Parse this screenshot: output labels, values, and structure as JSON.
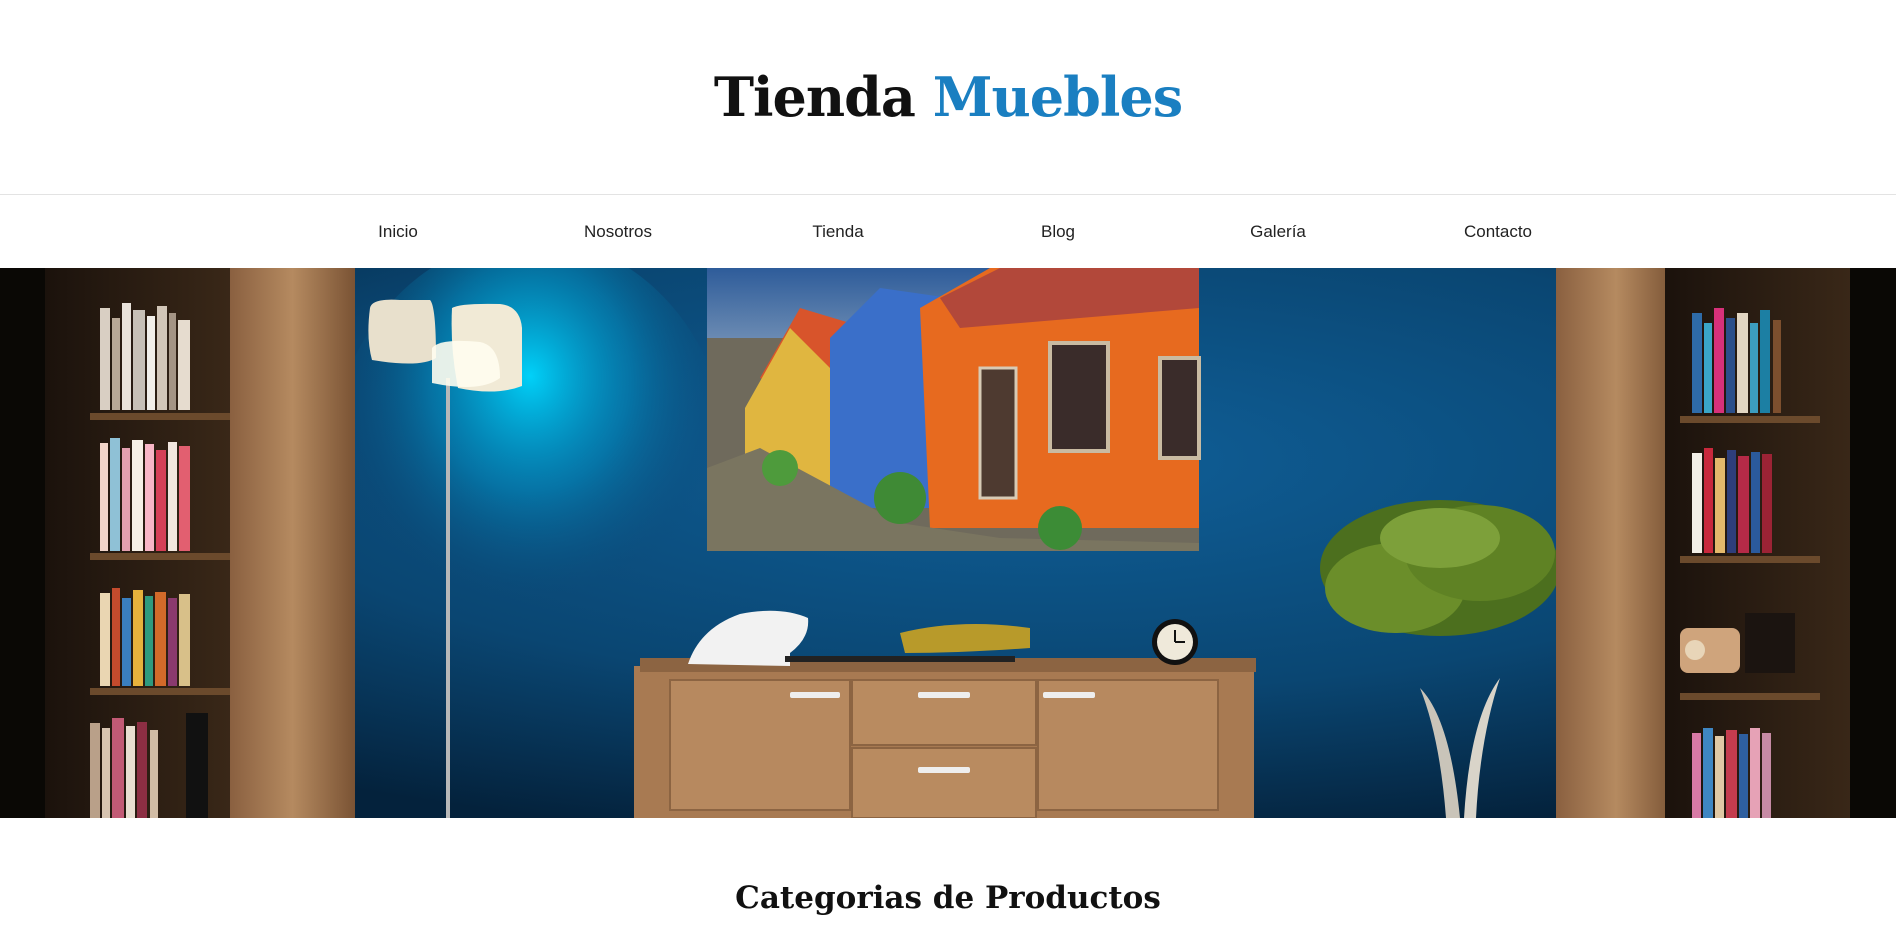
{
  "site": {
    "logo_part1": "Tienda",
    "logo_part2": "Muebles",
    "accent_color": "#1a7fc1"
  },
  "nav": {
    "items": [
      {
        "label": "Inicio"
      },
      {
        "label": "Nosotros"
      },
      {
        "label": "Tienda"
      },
      {
        "label": "Blog"
      },
      {
        "label": "Galería"
      },
      {
        "label": "Contacto"
      }
    ]
  },
  "hero": {
    "wall_color": "#0b4a7a"
  },
  "main": {
    "section_title": "Categorias de Productos"
  }
}
